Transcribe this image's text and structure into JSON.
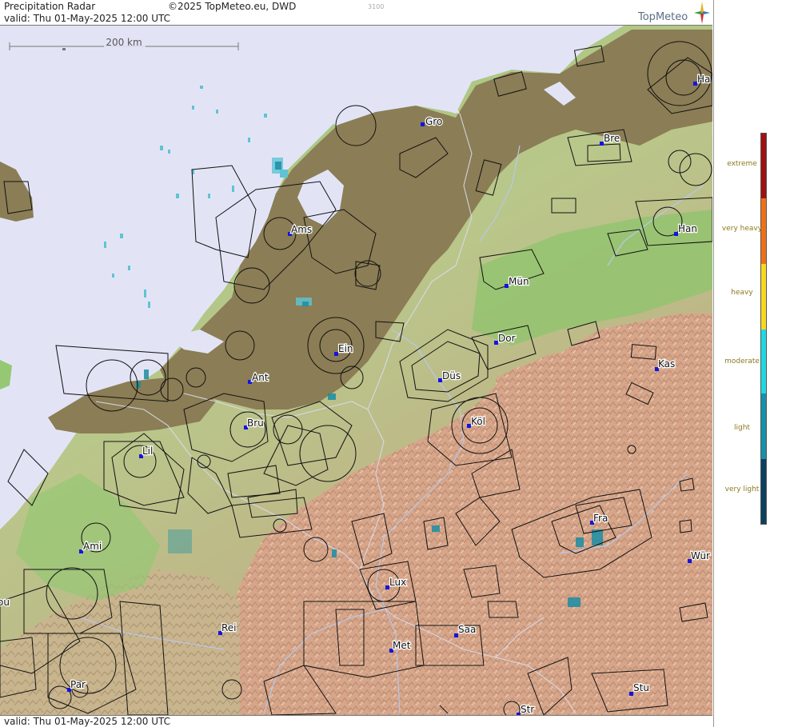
{
  "header": {
    "title": "Precipitation Radar",
    "copyright": "©2025 TopMeteo.eu, DWD",
    "code": "3100",
    "valid": "valid:  Thu  01-May-2025 12:00 UTC",
    "brand": "TopMeteo"
  },
  "footer": {
    "valid": "valid:  Thu  01-May-2025 12:00 UTC"
  },
  "scale_bar": {
    "label": "200 km"
  },
  "cities": [
    {
      "label": "Gro"
    },
    {
      "label": "Bre"
    },
    {
      "label": "Ha"
    },
    {
      "label": "Ams"
    },
    {
      "label": "Han"
    },
    {
      "label": "Mün"
    },
    {
      "label": "Ein"
    },
    {
      "label": "Dor"
    },
    {
      "label": "Kas"
    },
    {
      "label": "Ant"
    },
    {
      "label": "Düs"
    },
    {
      "label": "Bru"
    },
    {
      "label": "Köl"
    },
    {
      "label": "Lil"
    },
    {
      "label": "Fra"
    },
    {
      "label": "Ami"
    },
    {
      "label": "Wür"
    },
    {
      "label": "Lux"
    },
    {
      "label": "ou"
    },
    {
      "label": "Rei"
    },
    {
      "label": "Saa"
    },
    {
      "label": "Met"
    },
    {
      "label": "Par"
    },
    {
      "label": "Stu"
    },
    {
      "label": "Str"
    }
  ],
  "legend": {
    "levels": [
      {
        "label": "extreme",
        "color": "#a01010"
      },
      {
        "label": "very heavy",
        "color": "#f07018"
      },
      {
        "label": "heavy",
        "color": "#f8d820"
      },
      {
        "label": "moderate",
        "color": "#20d8e0"
      },
      {
        "label": "light",
        "color": "#1890a8"
      },
      {
        "label": "very light",
        "color": "#0c4060"
      }
    ]
  },
  "colors": {
    "sea": "#e2e4f6",
    "lowland": "#8b7d55",
    "plain": "#8fbf6e",
    "hills": "#d9a98a"
  }
}
